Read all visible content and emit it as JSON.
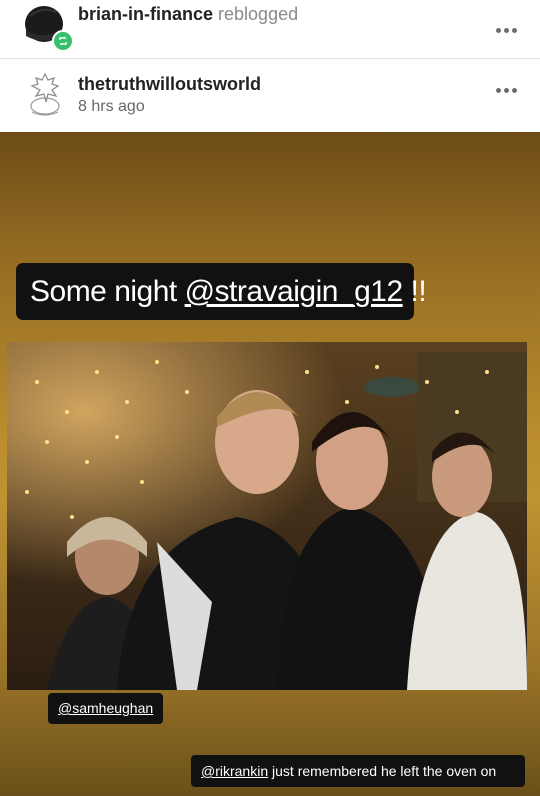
{
  "reblog": {
    "username": "brian-in-finance",
    "action": "reblogged"
  },
  "post": {
    "username": "thetruthwilloutsworld",
    "time": "8 hrs ago"
  },
  "story": {
    "caption_prefix": "Some night ",
    "caption_mention": "@stravaigin_g12",
    "caption_suffix": " !!",
    "tag1_mention": "@samheughan",
    "tag2_mention": "@rikrankin",
    "tag2_text": " just remembered he left the oven on"
  },
  "colors": {
    "badge": "#37c06b",
    "story_gold": "#b98c2d",
    "caption_bg": "#111111"
  },
  "icons": {
    "reblog_badge": "reblog-icon",
    "menu": "more-dots-icon"
  }
}
